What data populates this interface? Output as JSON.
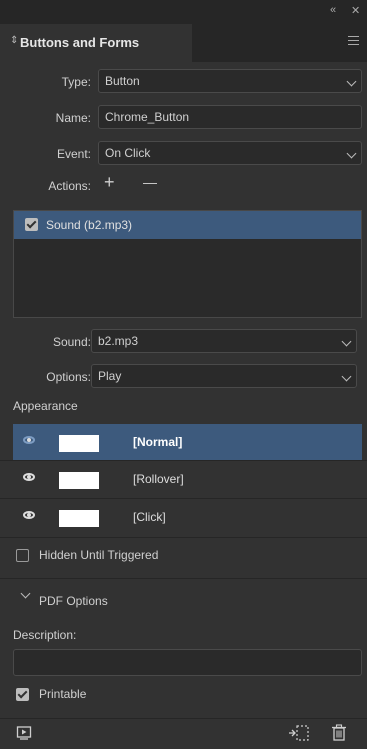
{
  "panel": {
    "collapse_glyph": "«",
    "close_glyph": "✕",
    "tab_glyph": "⇕",
    "title": "Buttons and Forms"
  },
  "form": {
    "type_label": "Type:",
    "type_value": "Button",
    "name_label": "Name:",
    "name_value": "Chrome_Button",
    "event_label": "Event:",
    "event_value": "On Click",
    "actions_label": "Actions:",
    "add_glyph": "+",
    "remove_glyph": "—"
  },
  "actions_list": [
    {
      "label": "Sound (b2.mp3)",
      "checked": true
    }
  ],
  "sound": {
    "sound_label": "Sound:",
    "sound_value": "b2.mp3",
    "options_label": "Options:",
    "options_value": "Play"
  },
  "appearance": {
    "label": "Appearance",
    "states": [
      {
        "label": "[Normal]",
        "selected": true
      },
      {
        "label": "[Rollover]",
        "selected": false
      },
      {
        "label": "[Click]",
        "selected": false
      }
    ]
  },
  "hidden_until_triggered": {
    "label": "Hidden Until Triggered",
    "checked": false
  },
  "pdf_options": {
    "label": "PDF Options",
    "description_label": "Description:",
    "description_value": "",
    "printable_label": "Printable",
    "printable_checked": true
  },
  "colors": {
    "panel_bg": "#323232",
    "header_bg": "#262626",
    "selection": "#3d5a7d"
  }
}
